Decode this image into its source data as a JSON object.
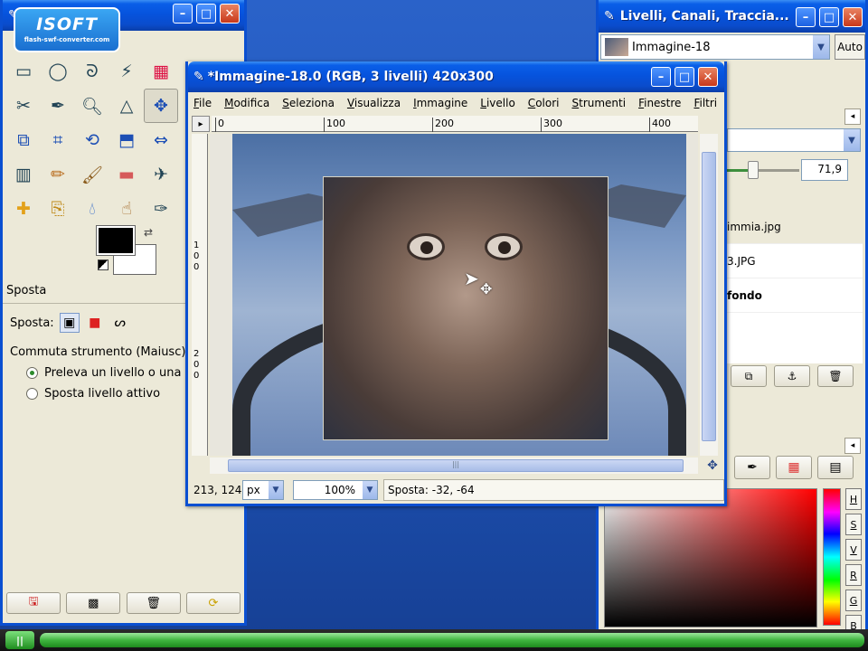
{
  "toolbox": {
    "logo_text": "ISOFT",
    "logo_subtext": "flash-swf-converter.com",
    "tools": [
      "rect-select-icon",
      "ellipse-select-icon",
      "lasso-icon",
      "fuzzy-select-icon",
      "select-by-color-icon",
      "scissors-icon",
      "color-picker-icon",
      "magnify-icon",
      "measure-icon",
      "move-icon",
      "align-icon",
      "crop-icon",
      "rotate-icon",
      "scale-icon",
      "flip-icon",
      "blend-icon",
      "pencil-icon",
      "paintbrush-icon",
      "eraser-icon",
      "airbrush-icon",
      "heal-icon",
      "clone-icon",
      "blur-icon",
      "smudge-icon",
      "ink-icon"
    ],
    "options": {
      "panel_title": "Sposta",
      "move_label": "Sposta:",
      "toggle_label": "Commuta strumento  (Maiusc)",
      "radio1": "Preleva un livello o una guida",
      "radio2": "Sposta livello attivo"
    }
  },
  "image_window": {
    "title": "*Immagine-18.0 (RGB, 3 livelli) 420x300",
    "menu": [
      "File",
      "Modifica",
      "Seleziona",
      "Visualizza",
      "Immagine",
      "Livello",
      "Colori",
      "Strumenti",
      "Finestre",
      "Filtri"
    ],
    "ruler_h": [
      "0",
      "100",
      "200",
      "300",
      "400"
    ],
    "ruler_v": [
      "1",
      "0",
      "0",
      "2",
      "0",
      "0"
    ],
    "status": {
      "coords": "213, 124",
      "unit": "px",
      "zoom": "100%",
      "message": "Sposta: -32, -64"
    }
  },
  "layers_window": {
    "title": "Livelli, Canali, Traccia...",
    "image_name": "Immagine-18",
    "auto_label": "Auto",
    "opacity": "71,9",
    "opacity_fraction": 0.719,
    "layers": [
      "immia.jpg",
      "3.JPG",
      "fondo"
    ],
    "hsv_buttons": [
      "H",
      "S",
      "V",
      "R",
      "G",
      "B"
    ]
  },
  "colors": {
    "title_blue": "#0a4fd1",
    "panel_bg": "#ece9d8",
    "progress_green": "#3fb53f"
  }
}
